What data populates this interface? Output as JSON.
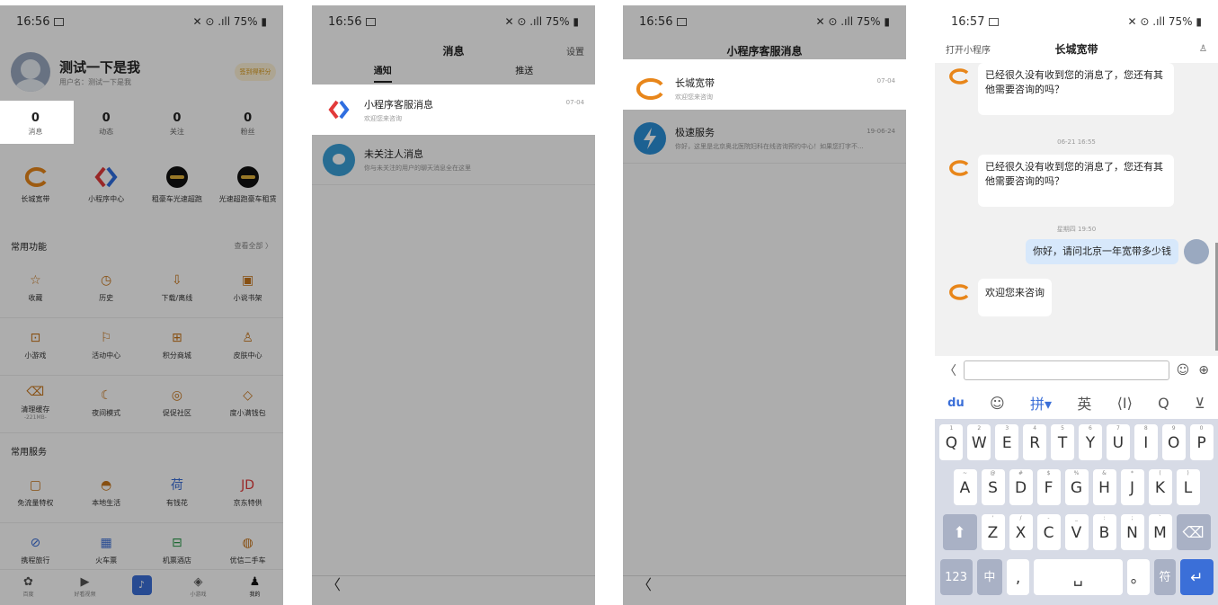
{
  "status": {
    "p1": {
      "time": "16:56",
      "icons": "✕ ⊙ .ıll",
      "battery": "75%"
    },
    "p2": {
      "time": "16:56",
      "icons": "✕ ⊙ .ıll",
      "battery": "75%"
    },
    "p3": {
      "time": "16:56",
      "icons": "✕ ⊙ .ıll",
      "battery": "75%"
    },
    "p4": {
      "time": "16:57",
      "icons": "✕ ⊙ .ıll",
      "battery": "75%"
    }
  },
  "profile": {
    "name": "测试一下是我",
    "sub": "用户名：测试一下是我",
    "signin": "签到得积分"
  },
  "stats": [
    {
      "n": "0",
      "l": "消息"
    },
    {
      "n": "0",
      "l": "动态"
    },
    {
      "n": "0",
      "l": "关注"
    },
    {
      "n": "0",
      "l": "粉丝"
    }
  ],
  "apps": [
    {
      "label": "长城宽带"
    },
    {
      "label": "小程序中心"
    },
    {
      "label": "租豪车光速超跑"
    },
    {
      "label": "光速超跑豪车租赁"
    }
  ],
  "common": {
    "title": "常用功能",
    "more": "查看全部 〉",
    "rows": [
      [
        {
          "i": "☆",
          "l": "收藏"
        },
        {
          "i": "◷",
          "l": "历史"
        },
        {
          "i": "⇩",
          "l": "下载/离线"
        },
        {
          "i": "▣",
          "l": "小说书架"
        }
      ],
      [
        {
          "i": "⊡",
          "l": "小游戏"
        },
        {
          "i": "⚐",
          "l": "活动中心"
        },
        {
          "i": "⊞",
          "l": "积分商城"
        },
        {
          "i": "♙",
          "l": "皮肤中心"
        }
      ],
      [
        {
          "i": "⌫",
          "l": "清理缓存",
          "sub": "-221MB-"
        },
        {
          "i": "☾",
          "l": "夜间模式"
        },
        {
          "i": "◎",
          "l": "促促社区"
        },
        {
          "i": "◇",
          "l": "度小满钱包"
        }
      ]
    ]
  },
  "services": {
    "title": "常用服务",
    "rows": [
      [
        {
          "i": "▢",
          "l": "免流量特权"
        },
        {
          "i": "◓",
          "l": "本地生活"
        },
        {
          "i": "荷",
          "l": "有钱花"
        },
        {
          "i": "JD",
          "l": "京东特供"
        }
      ],
      [
        {
          "i": "⊘",
          "l": "携程旅行"
        },
        {
          "i": "▦",
          "l": "火车票"
        },
        {
          "i": "⊟",
          "l": "机票酒店"
        },
        {
          "i": "◍",
          "l": "优信二手车"
        }
      ]
    ]
  },
  "tabbar": [
    {
      "i": "✿",
      "l": "百度"
    },
    {
      "i": "▶",
      "l": "好看视频"
    },
    {
      "i": "♪",
      "l": ""
    },
    {
      "i": "◈",
      "l": "小游戏"
    },
    {
      "i": "♟",
      "l": "我的"
    }
  ],
  "messages": {
    "title": "消息",
    "settings": "设置",
    "tab_notify": "通知",
    "tab_push": "推送",
    "items": [
      {
        "title": "小程序客服消息",
        "sub": "欢迎您来咨询",
        "date": "07-04"
      },
      {
        "title": "未关注人消息",
        "sub": "你与未关注的用户的聊天消息全在这里",
        "date": ""
      }
    ]
  },
  "cs": {
    "title": "小程序客服消息",
    "items": [
      {
        "title": "长城宽带",
        "sub": "欢迎您来咨询",
        "date": "07-04"
      },
      {
        "title": "极速服务",
        "sub": "你好，这里是北京奥北医院妇科在线咨询预约中心！如果您打字不...",
        "date": "19-06-24"
      }
    ]
  },
  "chat": {
    "open": "打开小程序",
    "title": "长城宽带",
    "msg1": "已经很久没有收到您的消息了，您还有其他需要咨询的吗？",
    "time1": "06-21 16:55",
    "msg2": "已经很久没有收到您的消息了，您还有其他需要咨询的吗？",
    "time2": "星期四 19:50",
    "me": "你好，请问北京一年宽带多少钱",
    "msg3": "欢迎您来咨询"
  },
  "ime": {
    "pinyin": "拼▾",
    "eng": "英"
  },
  "keys": {
    "row1": [
      [
        "Q",
        "1"
      ],
      [
        "W",
        "2"
      ],
      [
        "E",
        "3"
      ],
      [
        "R",
        "4"
      ],
      [
        "T",
        "5"
      ],
      [
        "Y",
        "6"
      ],
      [
        "U",
        "7"
      ],
      [
        "I",
        "8"
      ],
      [
        "O",
        "9"
      ],
      [
        "P",
        "0"
      ]
    ],
    "row2": [
      [
        "A",
        "~"
      ],
      [
        "S",
        "@"
      ],
      [
        "D",
        "#"
      ],
      [
        "F",
        "$"
      ],
      [
        "G",
        "%"
      ],
      [
        "H",
        "&"
      ],
      [
        "J",
        "*"
      ],
      [
        "K",
        "("
      ],
      [
        "L",
        ")"
      ]
    ],
    "row3": [
      [
        "Z",
        "'"
      ],
      [
        "X",
        "/"
      ],
      [
        "C",
        "-"
      ],
      [
        "V",
        "_"
      ],
      [
        "B",
        ":"
      ],
      [
        "N",
        ";"
      ],
      [
        "M",
        "`"
      ]
    ],
    "num": "123",
    "zh": "中",
    "sym": "符"
  }
}
